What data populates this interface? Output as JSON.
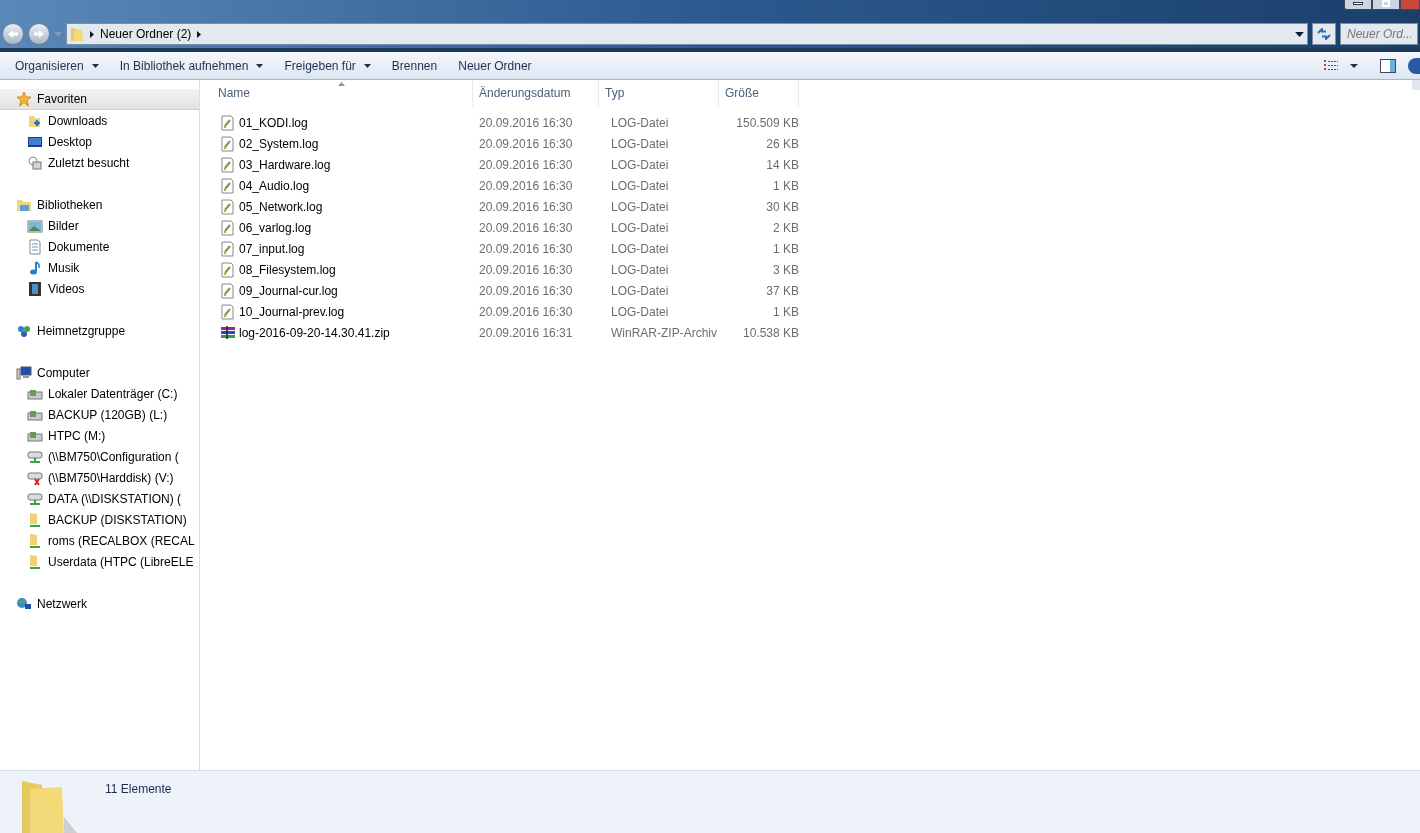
{
  "address_bar": {
    "crumbs": [
      "Neuer Ordner (2)"
    ]
  },
  "search": {
    "placeholder": "Neuer Ord..."
  },
  "toolbar": [
    {
      "label": "Organisieren",
      "dropdown": true
    },
    {
      "label": "In Bibliothek aufnehmen",
      "dropdown": true
    },
    {
      "label": "Freigeben für",
      "dropdown": true
    },
    {
      "label": "Brennen",
      "dropdown": false
    },
    {
      "label": "Neuer Ordner",
      "dropdown": false
    }
  ],
  "sidebar": {
    "groups": [
      {
        "label": "Favoriten",
        "kind": "star",
        "selected": true,
        "items": [
          {
            "label": "Downloads",
            "kind": "download"
          },
          {
            "label": "Desktop",
            "kind": "desktop"
          },
          {
            "label": "Zuletzt besucht",
            "kind": "recent"
          }
        ]
      },
      {
        "label": "Bibliotheken",
        "kind": "library",
        "selected": false,
        "items": [
          {
            "label": "Bilder",
            "kind": "picture"
          },
          {
            "label": "Dokumente",
            "kind": "document"
          },
          {
            "label": "Musik",
            "kind": "music"
          },
          {
            "label": "Videos",
            "kind": "film"
          }
        ]
      },
      {
        "label": "Heimnetzgruppe",
        "kind": "homegroup",
        "selected": false
      },
      {
        "label": "Computer",
        "kind": "computer",
        "selected": false,
        "items": [
          {
            "label": "Lokaler Datenträger (C:)",
            "kind": "drive"
          },
          {
            "label": "BACKUP (120GB) (L:)",
            "kind": "drive"
          },
          {
            "label": "HTPC (M:)",
            "kind": "drive"
          },
          {
            "label": "(\\\\BM750\\Configuration (",
            "kind": "netdrive"
          },
          {
            "label": "(\\\\BM750\\Harddisk) (V:)",
            "kind": "netdriveoff"
          },
          {
            "label": "DATA (\\\\DISKSTATION) (",
            "kind": "netdrive"
          },
          {
            "label": "BACKUP (DISKSTATION)",
            "kind": "netfolder"
          },
          {
            "label": "roms (RECALBOX (RECAL",
            "kind": "netfolder"
          },
          {
            "label": "Userdata (HTPC (LibreELE",
            "kind": "netfolder"
          }
        ]
      },
      {
        "label": "Netzwerk",
        "kind": "network",
        "selected": false
      }
    ]
  },
  "table": {
    "columns": [
      "Name",
      "Änderungsdatum",
      "Typ",
      "Größe"
    ],
    "rows": [
      {
        "kind": "log",
        "name": "01_KODI.log",
        "date": "20.09.2016 16:30",
        "type": "LOG-Datei",
        "size": "150.509 KB"
      },
      {
        "kind": "log",
        "name": "02_System.log",
        "date": "20.09.2016 16:30",
        "type": "LOG-Datei",
        "size": "26 KB"
      },
      {
        "kind": "log",
        "name": "03_Hardware.log",
        "date": "20.09.2016 16:30",
        "type": "LOG-Datei",
        "size": "14 KB"
      },
      {
        "kind": "log",
        "name": "04_Audio.log",
        "date": "20.09.2016 16:30",
        "type": "LOG-Datei",
        "size": "1 KB"
      },
      {
        "kind": "log",
        "name": "05_Network.log",
        "date": "20.09.2016 16:30",
        "type": "LOG-Datei",
        "size": "30 KB"
      },
      {
        "kind": "log",
        "name": "06_varlog.log",
        "date": "20.09.2016 16:30",
        "type": "LOG-Datei",
        "size": "2 KB"
      },
      {
        "kind": "log",
        "name": "07_input.log",
        "date": "20.09.2016 16:30",
        "type": "LOG-Datei",
        "size": "1 KB"
      },
      {
        "kind": "log",
        "name": "08_Filesystem.log",
        "date": "20.09.2016 16:30",
        "type": "LOG-Datei",
        "size": "3 KB"
      },
      {
        "kind": "log",
        "name": "09_Journal-cur.log",
        "date": "20.09.2016 16:30",
        "type": "LOG-Datei",
        "size": "37 KB"
      },
      {
        "kind": "log",
        "name": "10_Journal-prev.log",
        "date": "20.09.2016 16:30",
        "type": "LOG-Datei",
        "size": "1 KB"
      },
      {
        "kind": "zip",
        "name": "log-2016-09-20-14.30.41.zip",
        "date": "20.09.2016 16:31",
        "type": "WinRAR-ZIP-Archiv",
        "size": "10.538 KB"
      }
    ]
  },
  "status_bar": {
    "count": "11 Elemente"
  }
}
